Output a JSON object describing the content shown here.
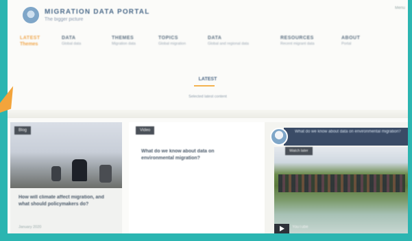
{
  "header": {
    "brand_title": "MIGRATION DATA PORTAL",
    "brand_subtitle": "The bigger picture",
    "corner_label": "Menu"
  },
  "nav": {
    "items": [
      {
        "label": "LATEST",
        "sub": "Themes"
      },
      {
        "label": "DATA",
        "sub": "Global data"
      },
      {
        "label": "THEMES",
        "sub": "Migration data"
      },
      {
        "label": "TOPICS",
        "sub": "Global migration"
      },
      {
        "label": "DATA",
        "sub": "Global and regional data"
      },
      {
        "label": "RESOURCES",
        "sub": "Recent migrant data"
      },
      {
        "label": "ABOUT",
        "sub": "Portal"
      }
    ]
  },
  "latest": {
    "heading": "LATEST",
    "subtitle": "Selected latest content"
  },
  "cards": [
    {
      "tag": "Blog",
      "title": "How will climate affect migration, and what should policymakers do?",
      "date": "January 2020"
    },
    {
      "tag": "Video",
      "title": "What do we know about data on environmental migration?"
    },
    {
      "banner": "What do we know about data on environmental migration?",
      "tag": "Watch later",
      "channel": "YouTube"
    }
  ],
  "colors": {
    "frame": "#2bb5b1",
    "accent_orange": "#f0a64a",
    "nav_text": "#5a6e80"
  }
}
